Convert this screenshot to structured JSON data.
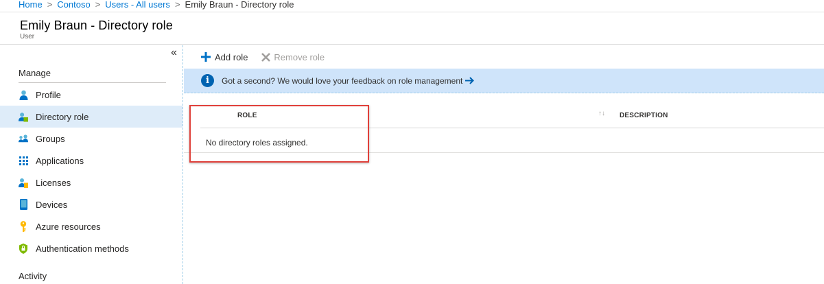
{
  "breadcrumb": {
    "items": [
      "Home",
      "Contoso",
      "Users - All users"
    ],
    "current": "Emily Braun - Directory role",
    "separator": ">"
  },
  "header": {
    "title": "Emily Braun - Directory role",
    "subtitle": "User"
  },
  "sidebar": {
    "collapse_glyph": "«",
    "manage_label": "Manage",
    "items": [
      {
        "label": "Profile",
        "icon": "profile-icon"
      },
      {
        "label": "Directory role",
        "icon": "directory-role-icon",
        "active": true
      },
      {
        "label": "Groups",
        "icon": "groups-icon"
      },
      {
        "label": "Applications",
        "icon": "applications-icon"
      },
      {
        "label": "Licenses",
        "icon": "licenses-icon"
      },
      {
        "label": "Devices",
        "icon": "devices-icon"
      },
      {
        "label": "Azure resources",
        "icon": "key-icon"
      },
      {
        "label": "Authentication methods",
        "icon": "shield-icon"
      }
    ],
    "activity_label": "Activity"
  },
  "toolbar": {
    "add_role": "Add role",
    "remove_role": "Remove role"
  },
  "banner": {
    "text": "Got a second? We would love your feedback on role management"
  },
  "table": {
    "columns": [
      "ROLE",
      "DESCRIPTION"
    ],
    "empty_message": "No directory roles assigned."
  },
  "colors": {
    "accent": "#0078d4",
    "active_nav": "#deecf9",
    "banner_bg": "#cfe4fa",
    "highlight": "#e0403a"
  }
}
